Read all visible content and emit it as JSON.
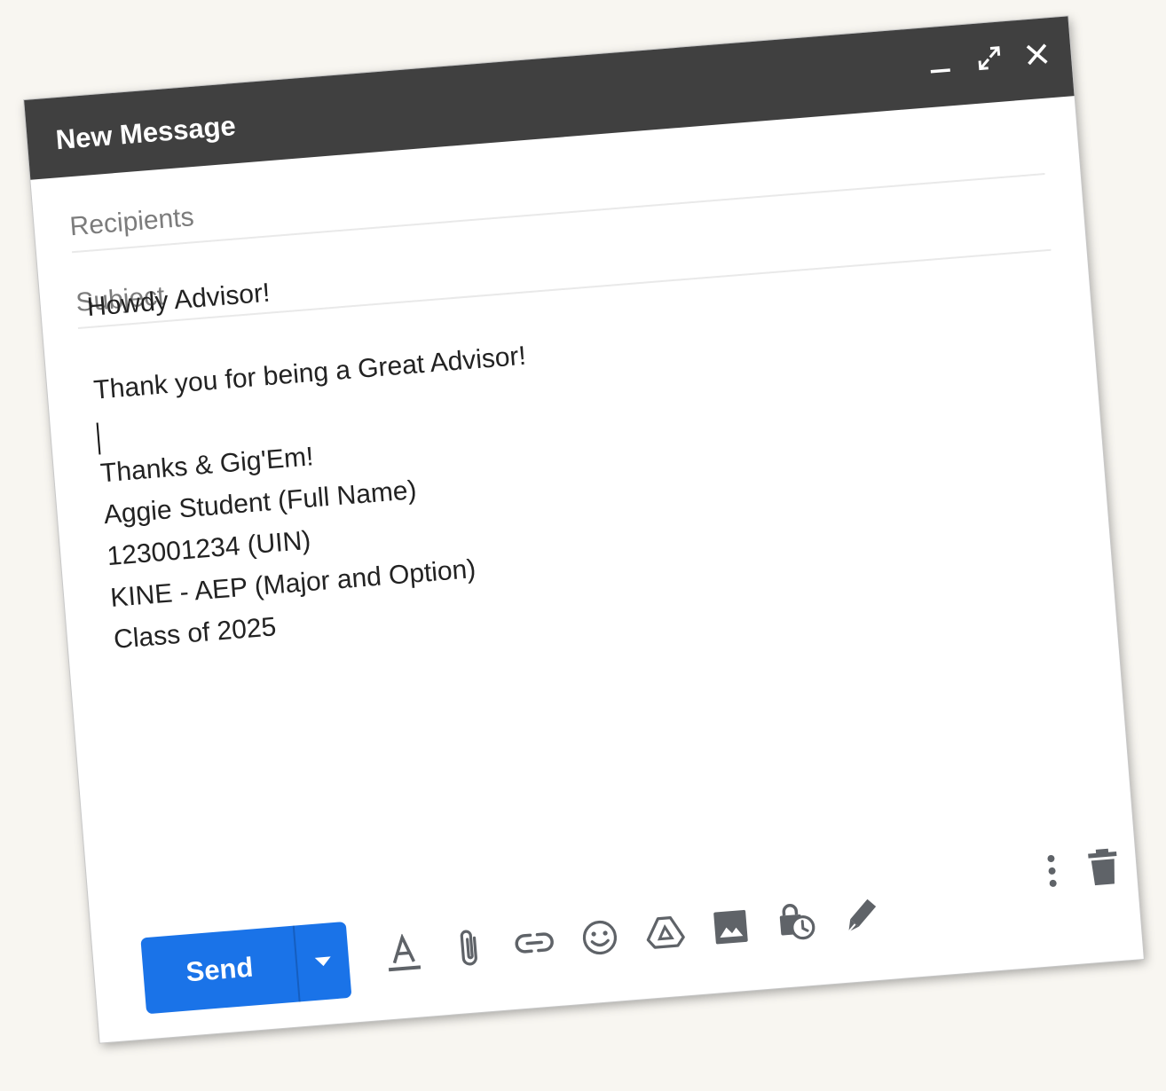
{
  "window": {
    "title": "New Message",
    "controls": [
      "minimize-icon",
      "expand-icon",
      "close-icon"
    ]
  },
  "fields": {
    "recipients_placeholder": "Recipients",
    "subject_placeholder": "Subject"
  },
  "message": {
    "greeting": "Howdy Advisor!",
    "body": "Thank you for being a Great Advisor!",
    "signoff": "Thanks & Gig'Em!",
    "name": "Aggie Student (Full Name)",
    "uin": "123001234 (UIN)",
    "major": "KINE - AEP (Major and Option)",
    "class": "Class of 2025"
  },
  "toolbar": {
    "send_label": "Send",
    "tools": [
      "formatting-icon",
      "attach-icon",
      "link-icon",
      "emoji-icon",
      "drive-icon",
      "photo-icon",
      "confidential-icon",
      "signature-icon"
    ],
    "right_tools": [
      "more-options-icon",
      "trash-icon"
    ]
  },
  "colors": {
    "header": "#404040",
    "send": "#1a73e8",
    "icon": "#5f6368",
    "background": "#f8f6f1"
  }
}
